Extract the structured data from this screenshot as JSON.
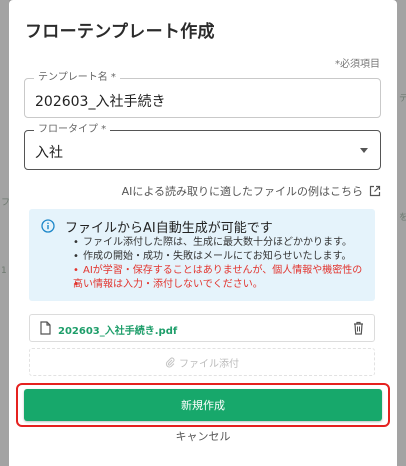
{
  "modal": {
    "title": "フローテンプレート作成",
    "required_note": "*必須項目"
  },
  "fields": {
    "template_name": {
      "label": "テンプレート名 *",
      "value": "202603_入社手続き"
    },
    "flow_type": {
      "label": "フロータイプ *",
      "value": "入社"
    }
  },
  "example_link": {
    "label": "AIによる読み取りに適したファイルの例はこちら",
    "icon": "external-link-icon"
  },
  "info": {
    "title": "ファイルからAI自動生成が可能です",
    "bullets": [
      "ファイル添付した際は、生成に最大数十分ほどかかります。",
      "作成の開始・成功・失敗はメールにてお知らせいたします。",
      "AIが学習・保存することはありませんが、個人情報や機密性の",
      "高い情報は入力・添付しないでください。"
    ],
    "colors": {
      "background": "#e5f3fb",
      "warning": "#e2342e"
    }
  },
  "file": {
    "name": "202603_入社手続き.pdf",
    "icon": "document-icon",
    "delete_icon": "trash-icon"
  },
  "attach": {
    "label": "ファイル添付",
    "icon": "paperclip-icon"
  },
  "actions": {
    "create": "新規作成",
    "cancel": "キャンセル"
  },
  "colors": {
    "primary": "#17a86b",
    "highlight_border": "#e5211f"
  },
  "background": {
    "right_stub_1": "テ",
    "right_stub_2": "を",
    "left_stub_1": "フ",
    "left_stub_2": "1"
  }
}
